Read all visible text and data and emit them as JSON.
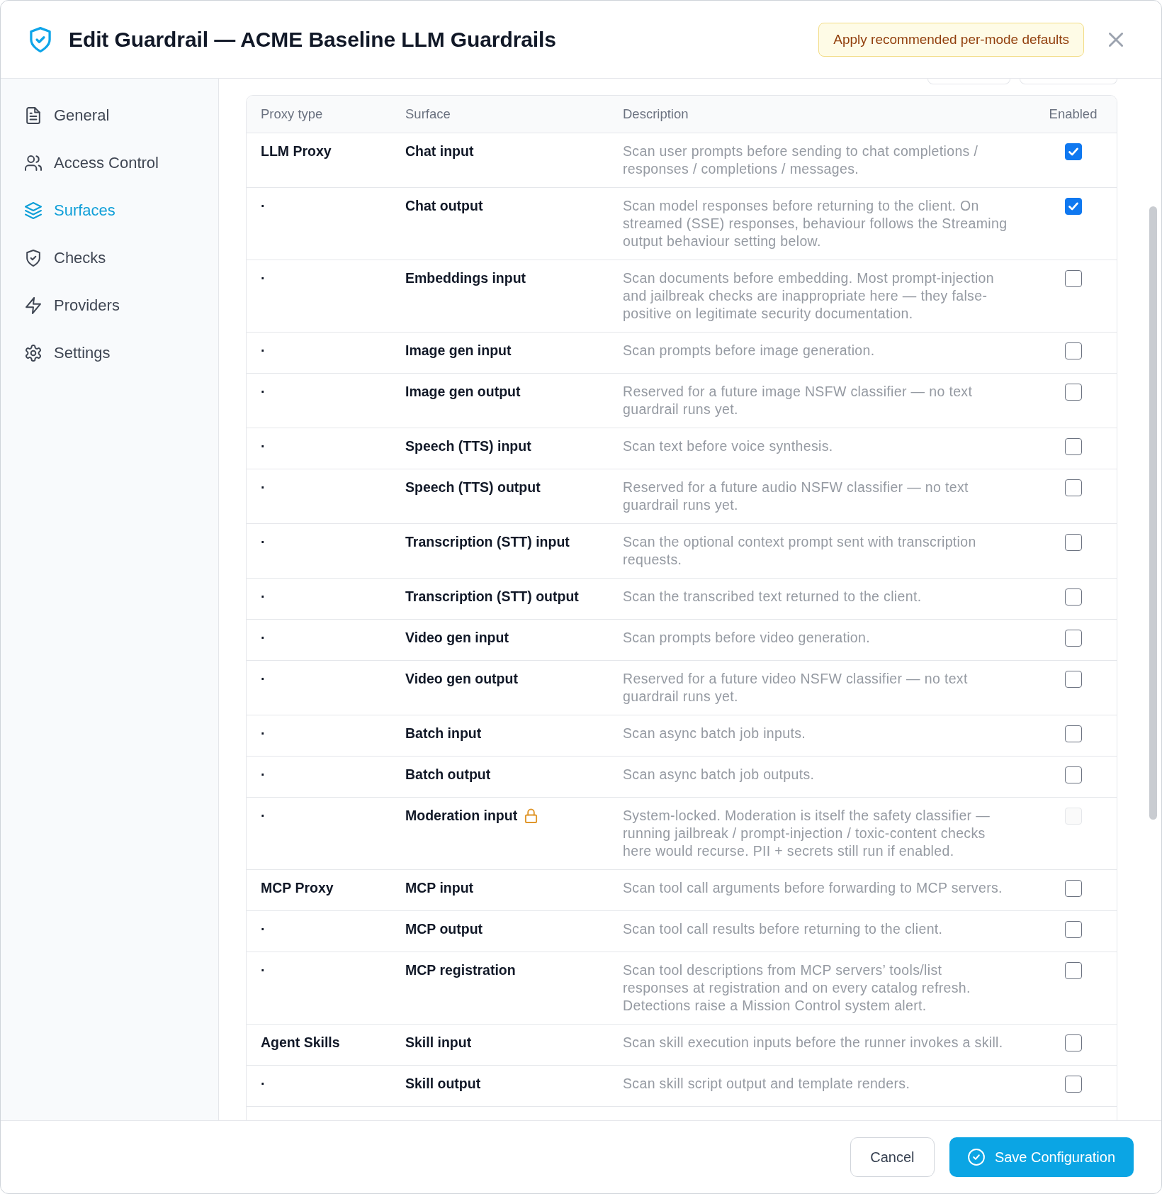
{
  "dialog": {
    "title": "Edit Guardrail — ACME Baseline LLM Guardrails",
    "header_button": "Apply recommended per-mode defaults"
  },
  "sidebar": {
    "items": [
      {
        "label": "General",
        "selected": false
      },
      {
        "label": "Access Control",
        "selected": false
      },
      {
        "label": "Surfaces",
        "selected": true
      },
      {
        "label": "Checks",
        "selected": false
      },
      {
        "label": "Providers",
        "selected": false
      },
      {
        "label": "Settings",
        "selected": false
      }
    ]
  },
  "table": {
    "columns": [
      "Proxy type",
      "Surface",
      "Description",
      "Enabled"
    ],
    "rows": [
      {
        "proxy_type": "LLM Proxy",
        "surface": "Chat input",
        "description": "Scan user prompts before sending to chat completions / responses / completions / messages.",
        "enabled": true,
        "locked": false
      },
      {
        "proxy_type": "·",
        "surface": "Chat output",
        "description": "Scan model responses before returning to the client. On streamed (SSE) responses, behaviour follows the Streaming output behaviour setting below.",
        "enabled": true,
        "locked": false
      },
      {
        "proxy_type": "·",
        "surface": "Embeddings input",
        "description": "Scan documents before embedding. Most prompt-injection and jailbreak checks are inappropriate here — they false-positive on legitimate security documentation.",
        "enabled": false,
        "locked": false
      },
      {
        "proxy_type": "·",
        "surface": "Image gen input",
        "description": "Scan prompts before image generation.",
        "enabled": false,
        "locked": false
      },
      {
        "proxy_type": "·",
        "surface": "Image gen output",
        "description": "Reserved for a future image NSFW classifier — no text guardrail runs yet.",
        "enabled": false,
        "locked": false
      },
      {
        "proxy_type": "·",
        "surface": "Speech (TTS) input",
        "description": "Scan text before voice synthesis.",
        "enabled": false,
        "locked": false
      },
      {
        "proxy_type": "·",
        "surface": "Speech (TTS) output",
        "description": "Reserved for a future audio NSFW classifier — no text guardrail runs yet.",
        "enabled": false,
        "locked": false
      },
      {
        "proxy_type": "·",
        "surface": "Transcription (STT) input",
        "description": "Scan the optional context prompt sent with transcription requests.",
        "enabled": false,
        "locked": false
      },
      {
        "proxy_type": "·",
        "surface": "Transcription (STT) output",
        "description": "Scan the transcribed text returned to the client.",
        "enabled": false,
        "locked": false
      },
      {
        "proxy_type": "·",
        "surface": "Video gen input",
        "description": "Scan prompts before video generation.",
        "enabled": false,
        "locked": false
      },
      {
        "proxy_type": "·",
        "surface": "Video gen output",
        "description": "Reserved for a future video NSFW classifier — no text guardrail runs yet.",
        "enabled": false,
        "locked": false
      },
      {
        "proxy_type": "·",
        "surface": "Batch input",
        "description": "Scan async batch job inputs.",
        "enabled": false,
        "locked": false
      },
      {
        "proxy_type": "·",
        "surface": "Batch output",
        "description": "Scan async batch job outputs.",
        "enabled": false,
        "locked": false
      },
      {
        "proxy_type": "·",
        "surface": "Moderation input",
        "description": "System-locked. Moderation is itself the safety classifier — running jailbreak / prompt-injection / toxic-content checks here would recurse. PII + secrets still run if enabled.",
        "enabled": false,
        "locked": true
      },
      {
        "proxy_type": "MCP Proxy",
        "surface": "MCP input",
        "description": "Scan tool call arguments before forwarding to MCP servers.",
        "enabled": false,
        "locked": false
      },
      {
        "proxy_type": "·",
        "surface": "MCP output",
        "description": "Scan tool call results before returning to the client.",
        "enabled": false,
        "locked": false
      },
      {
        "proxy_type": "·",
        "surface": "MCP registration",
        "description": "Scan tool descriptions from MCP servers’ tools/list responses at registration and on every catalog refresh. Detections raise a Mission Control system alert.",
        "enabled": false,
        "locked": false
      },
      {
        "proxy_type": "Agent Skills",
        "surface": "Skill input",
        "description": "Scan skill execution inputs before the runner invokes a skill.",
        "enabled": false,
        "locked": false
      },
      {
        "proxy_type": "·",
        "surface": "Skill output",
        "description": "Scan skill script output and template renders.",
        "enabled": false,
        "locked": false
      }
    ]
  },
  "footer": {
    "buttons": [
      {
        "kind": "secondary",
        "label": "Cancel"
      },
      {
        "kind": "primary",
        "label": "Save Configuration"
      }
    ]
  }
}
